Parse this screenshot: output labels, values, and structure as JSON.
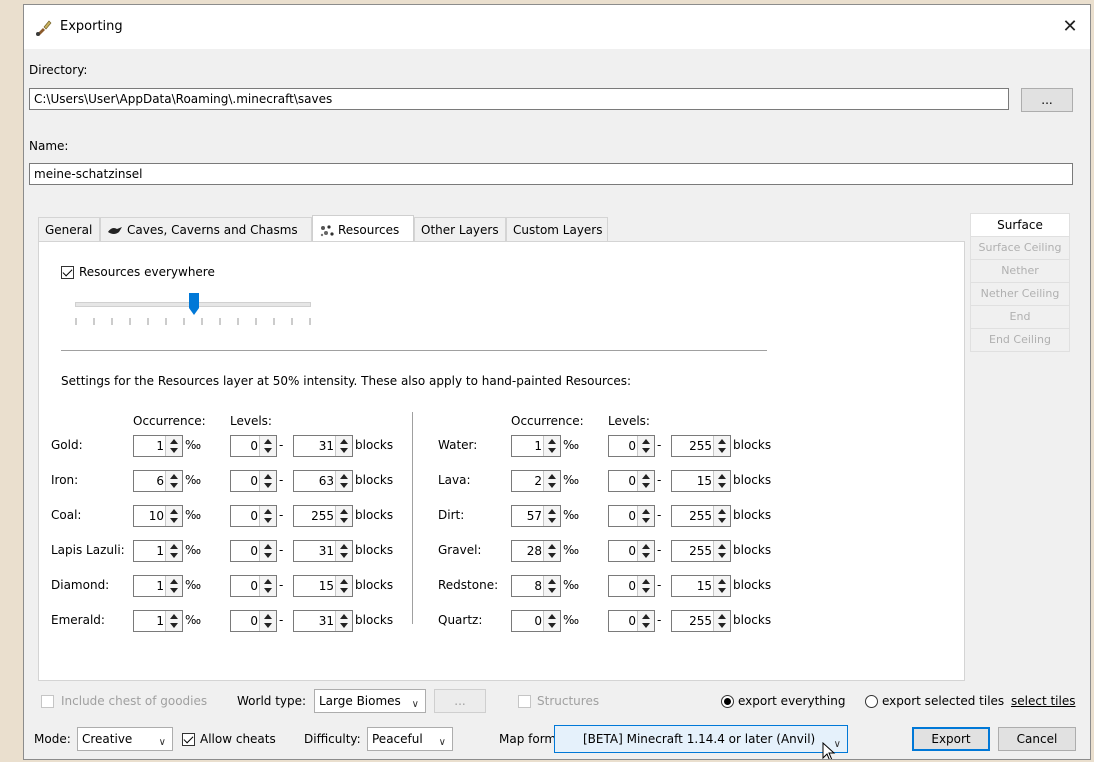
{
  "window": {
    "title": "Exporting",
    "close": "✕"
  },
  "directory": {
    "label": "Directory:",
    "value": "C:\\Users\\User\\AppData\\Roaming\\.minecraft\\saves",
    "browse_label": "..."
  },
  "name": {
    "label": "Name:",
    "value": "meine-schatzinsel"
  },
  "tabs": [
    "General",
    "Caves, Caverns and Chasms",
    "Resources",
    "Other Layers",
    "Custom Layers"
  ],
  "active_tab": "Resources",
  "dimensions": [
    "Surface",
    "Surface Ceiling",
    "Nether",
    "Nether Ceiling",
    "End",
    "End Ceiling"
  ],
  "resources": {
    "everywhere_label": "Resources everywhere",
    "everywhere_checked": true,
    "intensity": 0.5,
    "settings_text": "Settings for the Resources layer at 50% intensity. These also apply to hand-painted Resources:",
    "occurrence_header": "Occurrence:",
    "levels_header": "Levels:",
    "permille": "‰",
    "blocks": "blocks",
    "dash": "-",
    "left": [
      {
        "name": "Gold:",
        "occ": "1",
        "min": "0",
        "max": "31"
      },
      {
        "name": "Iron:",
        "occ": "6",
        "min": "0",
        "max": "63"
      },
      {
        "name": "Coal:",
        "occ": "10",
        "min": "0",
        "max": "255"
      },
      {
        "name": "Lapis Lazuli:",
        "occ": "1",
        "min": "0",
        "max": "31"
      },
      {
        "name": "Diamond:",
        "occ": "1",
        "min": "0",
        "max": "15"
      },
      {
        "name": "Emerald:",
        "occ": "1",
        "min": "0",
        "max": "31"
      }
    ],
    "right": [
      {
        "name": "Water:",
        "occ": "1",
        "min": "0",
        "max": "255"
      },
      {
        "name": "Lava:",
        "occ": "2",
        "min": "0",
        "max": "15"
      },
      {
        "name": "Dirt:",
        "occ": "57",
        "min": "0",
        "max": "255"
      },
      {
        "name": "Gravel:",
        "occ": "28",
        "min": "0",
        "max": "255"
      },
      {
        "name": "Redstone:",
        "occ": "8",
        "min": "0",
        "max": "15"
      },
      {
        "name": "Quartz:",
        "occ": "0",
        "min": "0",
        "max": "255"
      }
    ]
  },
  "bottom": {
    "include_chest": "Include chest of goodies",
    "world_type_label": "World type:",
    "world_type_value": "Large Biomes",
    "more_label": "...",
    "structures": "Structures",
    "export_everything": "export everything",
    "export_selected": "export selected tiles",
    "select_tiles": "select tiles",
    "mode_label": "Mode:",
    "mode_value": "Creative",
    "allow_cheats": "Allow cheats",
    "difficulty_label": "Difficulty:",
    "difficulty_value": "Peaceful",
    "map_format_label": "Map format:",
    "map_format_value": "[BETA] Minecraft 1.14.4 or later (Anvil)",
    "export_button": "Export",
    "cancel_button": "Cancel"
  },
  "colors": {
    "accent": "#0078d7",
    "window_bg": "#f0f0f0",
    "desktop": "#eadfce"
  }
}
